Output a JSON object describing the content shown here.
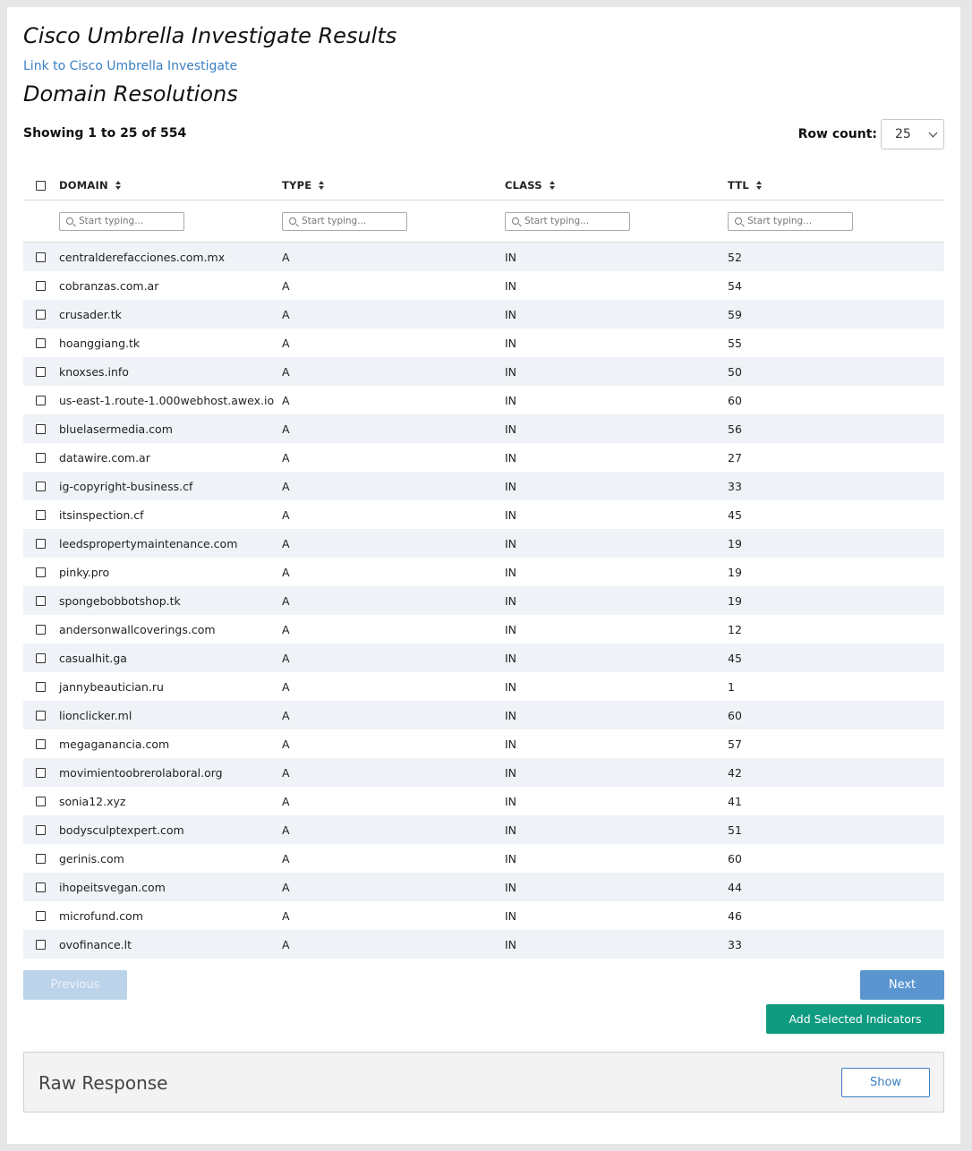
{
  "header": {
    "title": "Cisco Umbrella Investigate Results",
    "link_text": "Link to Cisco Umbrella Investigate",
    "subtitle": "Domain Resolutions"
  },
  "summary": {
    "showing": "Showing 1 to 25 of 554",
    "row_count_label": "Row count:",
    "row_count_value": "25"
  },
  "table": {
    "columns": [
      "DOMAIN",
      "TYPE",
      "CLASS",
      "TTL"
    ],
    "filter_placeholder": "Start typing...",
    "rows": [
      {
        "domain": "centralderefacciones.com.mx",
        "type": "A",
        "class": "IN",
        "ttl": "52"
      },
      {
        "domain": "cobranzas.com.ar",
        "type": "A",
        "class": "IN",
        "ttl": "54"
      },
      {
        "domain": "crusader.tk",
        "type": "A",
        "class": "IN",
        "ttl": "59"
      },
      {
        "domain": "hoanggiang.tk",
        "type": "A",
        "class": "IN",
        "ttl": "55"
      },
      {
        "domain": "knoxses.info",
        "type": "A",
        "class": "IN",
        "ttl": "50"
      },
      {
        "domain": "us-east-1.route-1.000webhost.awex.io",
        "type": "A",
        "class": "IN",
        "ttl": "60"
      },
      {
        "domain": "bluelasermedia.com",
        "type": "A",
        "class": "IN",
        "ttl": "56"
      },
      {
        "domain": "datawire.com.ar",
        "type": "A",
        "class": "IN",
        "ttl": "27"
      },
      {
        "domain": "ig-copyright-business.cf",
        "type": "A",
        "class": "IN",
        "ttl": "33"
      },
      {
        "domain": "itsinspection.cf",
        "type": "A",
        "class": "IN",
        "ttl": "45"
      },
      {
        "domain": "leedspropertymaintenance.com",
        "type": "A",
        "class": "IN",
        "ttl": "19"
      },
      {
        "domain": "pinky.pro",
        "type": "A",
        "class": "IN",
        "ttl": "19"
      },
      {
        "domain": "spongebobbotshop.tk",
        "type": "A",
        "class": "IN",
        "ttl": "19"
      },
      {
        "domain": "andersonwallcoverings.com",
        "type": "A",
        "class": "IN",
        "ttl": "12"
      },
      {
        "domain": "casualhit.ga",
        "type": "A",
        "class": "IN",
        "ttl": "45"
      },
      {
        "domain": "jannybeautician.ru",
        "type": "A",
        "class": "IN",
        "ttl": "1"
      },
      {
        "domain": "lionclicker.ml",
        "type": "A",
        "class": "IN",
        "ttl": "60"
      },
      {
        "domain": "megaganancia.com",
        "type": "A",
        "class": "IN",
        "ttl": "57"
      },
      {
        "domain": "movimientoobrerolaboral.org",
        "type": "A",
        "class": "IN",
        "ttl": "42"
      },
      {
        "domain": "sonia12.xyz",
        "type": "A",
        "class": "IN",
        "ttl": "41"
      },
      {
        "domain": "bodysculptexpert.com",
        "type": "A",
        "class": "IN",
        "ttl": "51"
      },
      {
        "domain": "gerinis.com",
        "type": "A",
        "class": "IN",
        "ttl": "60"
      },
      {
        "domain": "ihopeitsvegan.com",
        "type": "A",
        "class": "IN",
        "ttl": "44"
      },
      {
        "domain": "microfund.com",
        "type": "A",
        "class": "IN",
        "ttl": "46"
      },
      {
        "domain": "ovofinance.lt",
        "type": "A",
        "class": "IN",
        "ttl": "33"
      }
    ]
  },
  "pagination": {
    "previous_label": "Previous",
    "next_label": "Next"
  },
  "actions": {
    "add_selected_label": "Add Selected Indicators"
  },
  "raw_response": {
    "title": "Raw Response",
    "show_label": "Show"
  },
  "colors": {
    "link": "#3a7fc4",
    "next_button": "#5a95cf",
    "previous_button_disabled": "#bcd4ea",
    "add_button": "#0e9b80",
    "row_stripe": "#eff2f6"
  }
}
